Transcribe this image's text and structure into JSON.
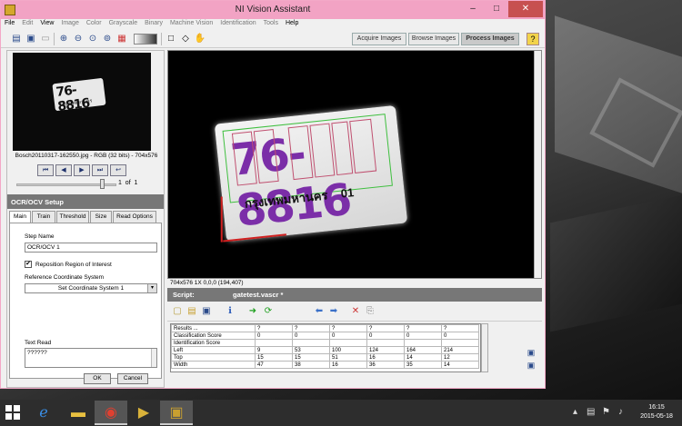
{
  "window": {
    "title": "NI Vision Assistant"
  },
  "menu": [
    "File",
    "Edit",
    "View",
    "Image",
    "Color",
    "Grayscale",
    "Binary",
    "Machine Vision",
    "Identification",
    "Tools",
    "Help"
  ],
  "mode_tabs": [
    "Acquire Images",
    "Browse Images",
    "Process Images"
  ],
  "thumbnail": {
    "caption": "Bosch20110317-162550.jpg - RGB (32 bits) - 704x576",
    "plate_number": "76-8816",
    "plate_text": "กรุงเทพมหานคร",
    "page": "1",
    "of_label": "of",
    "total": "1"
  },
  "ocr": {
    "header": "OCR/OCV Setup",
    "tabs": [
      "Main",
      "Train",
      "Threshold",
      "Size",
      "Read Options"
    ],
    "step_name_label": "Step Name",
    "step_name_value": "OCR/OCV 1",
    "reposition_label": "Reposition Region of Interest",
    "reposition_checked": "✔",
    "ref_coord_label": "Reference Coordinate System",
    "ref_coord_value": "Set Coordinate System 1",
    "text_read_label": "Text Read",
    "text_read_value": "??????",
    "ok_label": "OK",
    "cancel_label": "Cancel"
  },
  "image": {
    "plate_number": "76-8816",
    "plate_thai": "กรุงเทพมหานคร",
    "plate_suffix": "01",
    "status": "704x576 1X 0,0,0    (194,407)"
  },
  "script": {
    "label": "Script:",
    "file": "gatetest.vascr *"
  },
  "results": {
    "rows": [
      [
        "Results ...",
        "?",
        "?",
        "?",
        "?",
        "?",
        "?"
      ],
      [
        "Classification Score",
        "0",
        "0",
        "0",
        "0",
        "0",
        "0"
      ],
      [
        "Identification Score",
        "",
        "",
        "",
        "",
        "",
        ""
      ],
      [
        "Left",
        "9",
        "53",
        "100",
        "124",
        "164",
        "214"
      ],
      [
        "Top",
        "15",
        "15",
        "51",
        "16",
        "14",
        "12"
      ],
      [
        "Width",
        "47",
        "38",
        "16",
        "36",
        "35",
        "14"
      ]
    ]
  },
  "clock": {
    "time": "16:15",
    "date": "2015-05-18"
  }
}
